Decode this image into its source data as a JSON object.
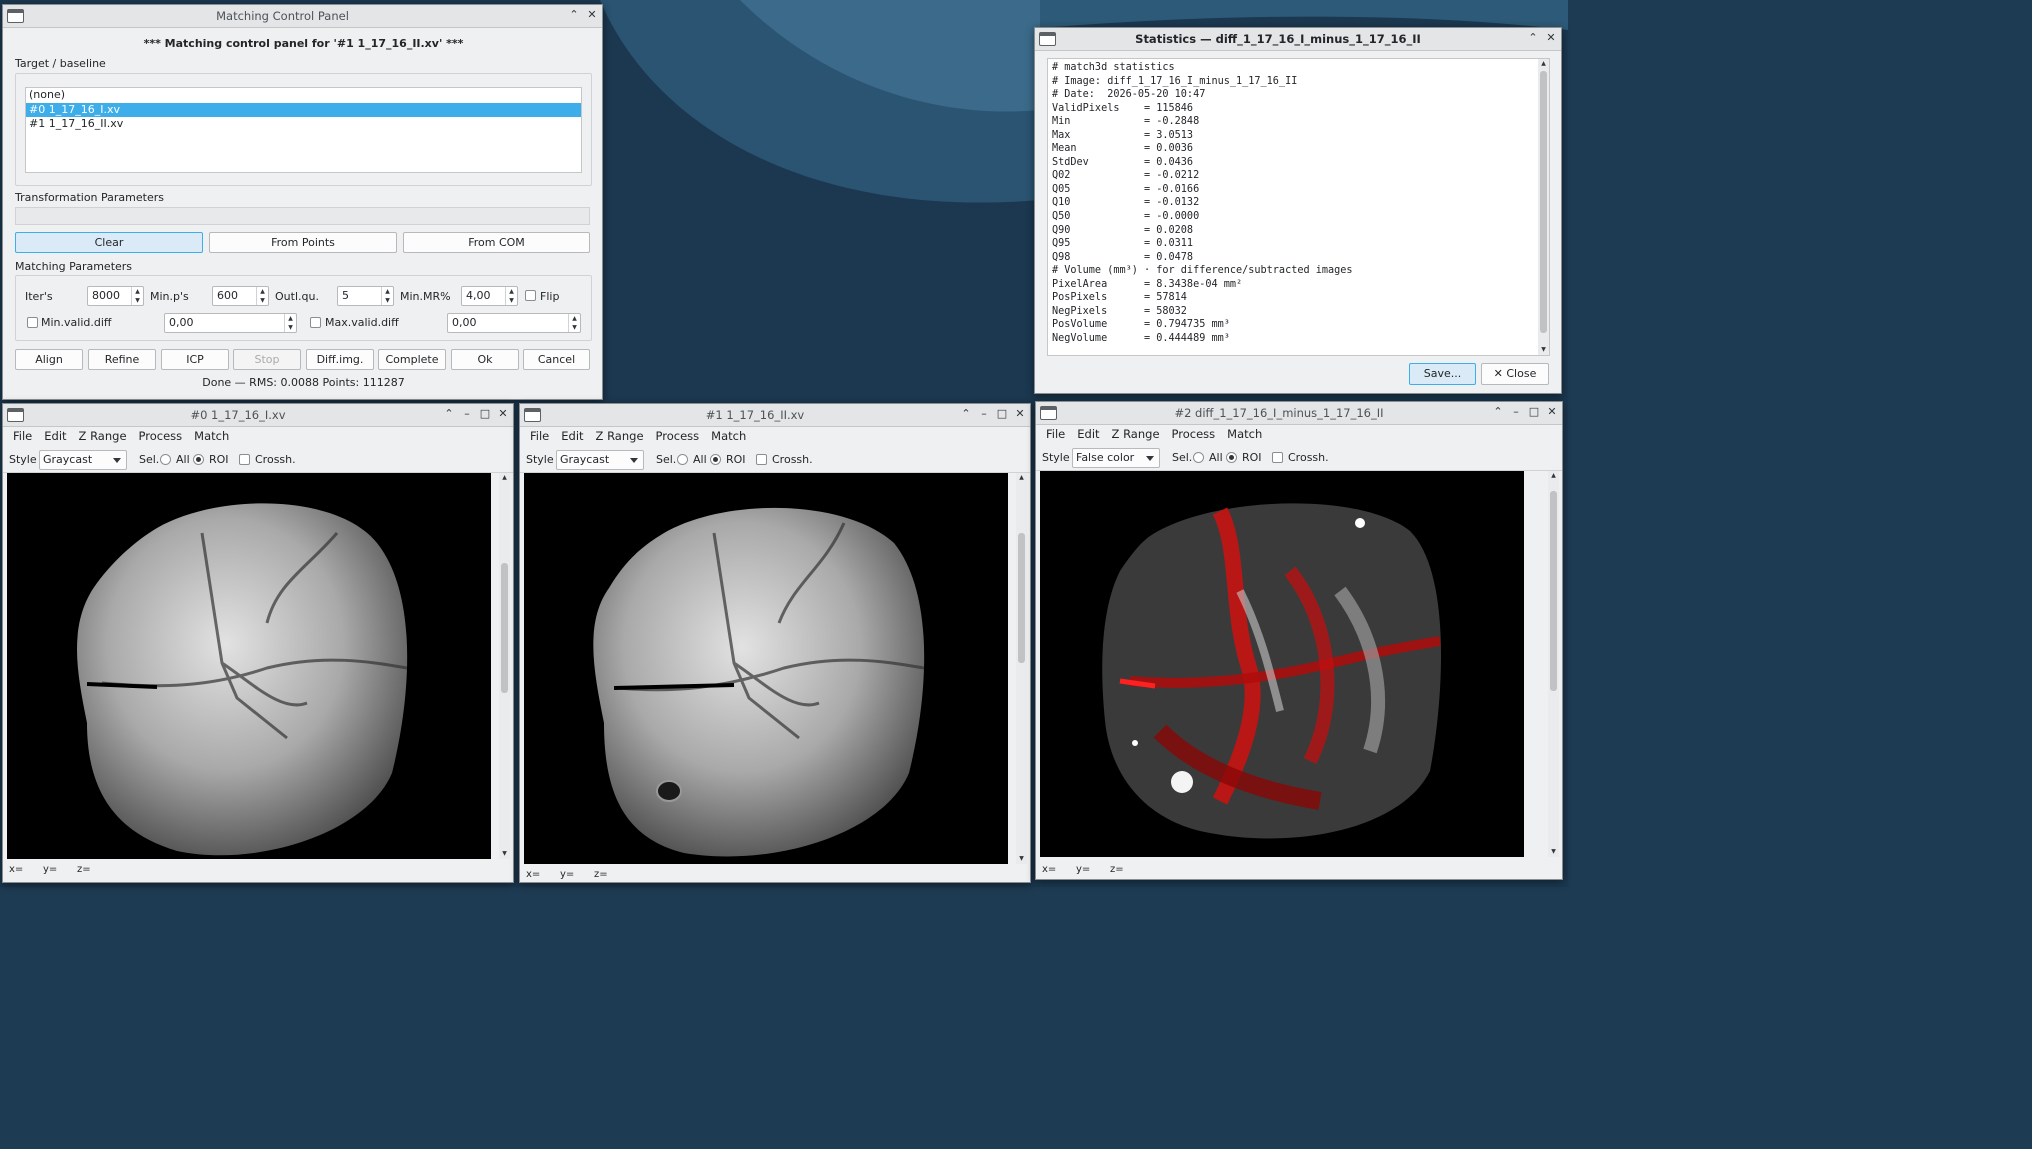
{
  "matching_panel": {
    "window_title": "Matching Control Panel",
    "header": "*** Matching control panel for '#1 1_17_16_II.xv' ***",
    "target_label": "Target / baseline",
    "targets": [
      "(none)",
      "#0 1_17_16_I.xv",
      "#1 1_17_16_II.xv"
    ],
    "selected_target": 1,
    "transform_label": "Transformation Parameters",
    "transform_value": "",
    "transform_buttons": [
      "Clear",
      "From Points",
      "From COM"
    ],
    "matching_label": "Matching Parameters",
    "iters_label": "Iter's",
    "iters_value": "8000",
    "minps_label": "Min.p's",
    "minps_value": "600",
    "outlqu_label": "Outl.qu.",
    "outlqu_value": "5",
    "minmr_label": "Min.MR%",
    "minmr_value": "4,00",
    "flip_label": "Flip",
    "flip_checked": false,
    "minvalid_label": "Min.valid.diff",
    "minvalid_checked": false,
    "minvalid_value": "0,00",
    "maxvalid_label": "Max.valid.diff",
    "maxvalid_checked": false,
    "maxvalid_value": "0,00",
    "actions": [
      "Align",
      "Refine",
      "ICP",
      "Stop",
      "Diff.img.",
      "Complete",
      "Ok",
      "Cancel"
    ],
    "status": "Done — RMS: 0.0088  Points: 111287"
  },
  "stats_window": {
    "title": "Statistics — diff_1_17_16_I_minus_1_17_16_II",
    "lines": [
      "# match3d statistics",
      "# Image: diff_1_17_16_I_minus_1_17_16_II",
      "# Date:  2026-05-20 10:47",
      "ValidPixels    = 115846",
      "Min            = -0.2848",
      "Max            = 3.0513",
      "Mean           = 0.0036",
      "StdDev         = 0.0436",
      "Q02            = -0.0212",
      "Q05            = -0.0166",
      "Q10            = -0.0132",
      "Q50            = -0.0000",
      "Q90            = 0.0208",
      "Q95            = 0.0311",
      "Q98            = 0.0478",
      "# Volume (mm³) · for difference/subtracted images",
      "PixelArea      = 8.3438e-04 mm²",
      "PosPixels      = 57814",
      "NegPixels      = 58032",
      "PosVolume      = 0.794735 mm³",
      "NegVolume      = 0.444489 mm³"
    ],
    "save_label": "Save...",
    "close_label": "Close"
  },
  "image_windows": [
    {
      "title": "#0 1_17_16_I.xv",
      "style": "Graycast"
    },
    {
      "title": "#1 1_17_16_II.xv",
      "style": "Graycast"
    },
    {
      "title": "#2 diff_1_17_16_I_minus_1_17_16_II",
      "style": "False color"
    }
  ],
  "menu": [
    "File",
    "Edit",
    "Z Range",
    "Process",
    "Match"
  ],
  "toolbar": {
    "style_label": "Style",
    "sel_label": "Sel.",
    "all_label": "All",
    "roi_label": "ROI",
    "crossh_label": "Crossh."
  },
  "coords": {
    "x": "x=",
    "y": "y=",
    "z": "z="
  },
  "colors": {
    "selection": "#3daee9",
    "desktop": "#1d3b53",
    "diff_positive": "#d01010"
  }
}
